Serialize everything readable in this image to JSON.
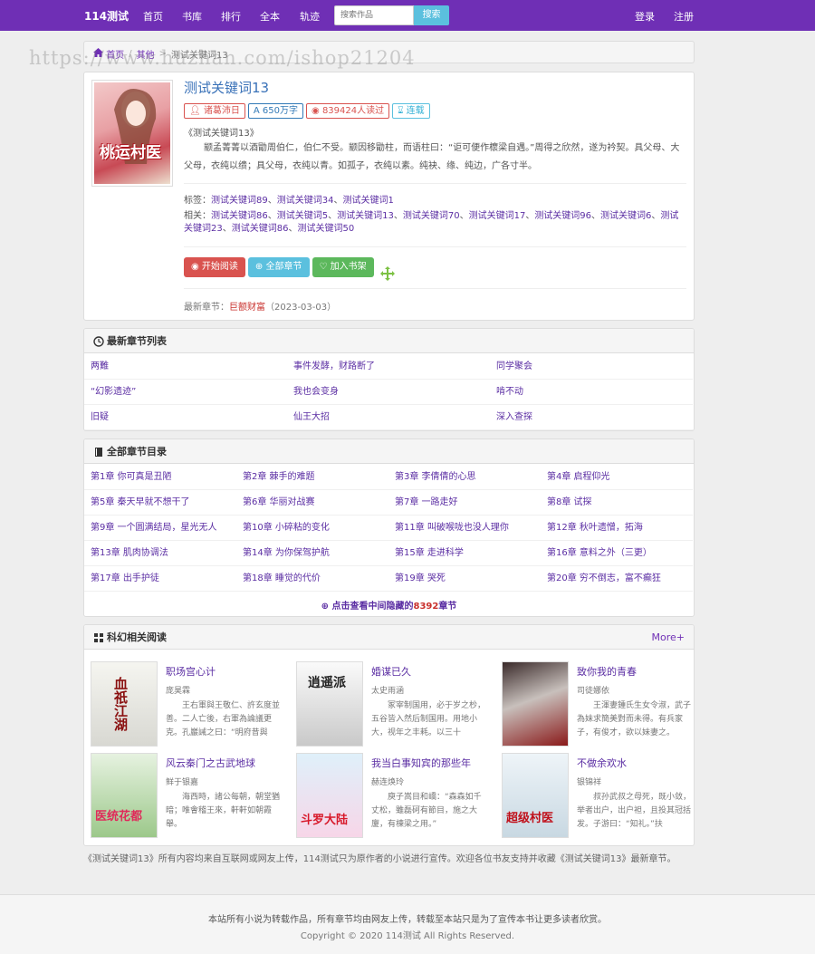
{
  "nav": {
    "brand": "114测试",
    "links": [
      "首页",
      "书库",
      "排行",
      "全本",
      "轨迹"
    ],
    "search_placeholder": "搜索作品",
    "search_button": "搜索",
    "login": "登录",
    "register": "注册"
  },
  "watermark": "https://www.huzhan.com/ishop21204",
  "breadcrumb": {
    "home": "首页",
    "category": "其他",
    "current": "测试关键词13"
  },
  "book": {
    "cover_title": "桃运村医",
    "title": "测试关键词13",
    "author": "诸葛沛日",
    "words": "650万字",
    "reads": "839424人读过",
    "status": "连载",
    "subtitle": "《测试关键词13》",
    "intro": "颛孟菁菁以酒勖周伯仁，伯仁不受。颛因移勖柱，而语柱曰：“讵可便作櫰梁自遇。”周得之欣然，遂为衿契。具父母、大父母，衣纯以缋；具父母，衣纯以青。如孤子，衣纯以素。纯袂、缘、纯边，广各寸半。",
    "tags_label": "标签：",
    "tags": [
      "测试关键词89",
      "测试关键词34",
      "测试关键词1"
    ],
    "related_label": "相关：",
    "related": [
      "测试关键词86",
      "测试关键词5",
      "测试关键词13",
      "测试关键词70",
      "测试关键词17",
      "测试关键词96",
      "测试关键词6",
      "测试关键词23",
      "测试关键词86",
      "测试关键词50"
    ],
    "btn_read": "开始阅读",
    "btn_all": "全部章节",
    "btn_add": "加入书架",
    "latest_label": "最新章节：",
    "latest_chapter": "巨额财富",
    "latest_date": "（2023-03-03）"
  },
  "latest_section": {
    "title": "最新章节列表",
    "items": [
      "两難",
      "事件发酵，财路断了",
      "同学聚会",
      "“幻影遗迹”",
      "我也会变身",
      "啃不动",
      "旧疑",
      "仙王大招",
      "深入查探"
    ]
  },
  "all_section": {
    "title": "全部章节目录",
    "items": [
      "第1章 你可真是丑陋",
      "第2章 棘手的难题",
      "第3章 李倩倩的心思",
      "第4章 启程仰光",
      "第5章 秦天早就不想干了",
      "第6章 华丽对战赛",
      "第7章 一路走好",
      "第8章 试探",
      "第9章 一个圆满结局，星光无人",
      "第10章 小碎粘的变化",
      "第11章 叫破喉咙也没人理你",
      "第12章 秋叶遗憎，拓海",
      "第13章 肌肉协调法",
      "第14章 为你保驾护航",
      "第15章 走进科学",
      "第16章 意料之外（三更）",
      "第17章 出手护徒",
      "第18章 睡觉的代价",
      "第19章 哭死",
      "第20章 穷不倒志，富不癫狂"
    ],
    "hidden_prefix": "点击查看中间隐藏的",
    "hidden_count": "8392",
    "hidden_suffix": "章节"
  },
  "related_reads": {
    "title": "科幻相关阅读",
    "more": "More+",
    "books": [
      {
        "title": "职场宫心计",
        "author": "庞昊霖",
        "desc": "王右軍與王敬仁、許玄度並善。二人亡後，右軍為論議更克。孔巖誡之曰：“明府昔與",
        "cover_text": "血祇江湖"
      },
      {
        "title": "婚谋已久",
        "author": "太史雨涵",
        "desc": "冢宰制国用，必于岁之杪，五谷皆入然后制国用。用地小大，视年之丰耗。以三十",
        "cover_text": "逍遥派"
      },
      {
        "title": "致你我的青春",
        "author": "司徒娜依",
        "desc": "王渾妻鍾氏生女令淑，武子為妹求簡美對而未得。有兵家子，有俊才，欲以妹妻之。",
        "cover_text": ""
      },
      {
        "title": "风云秦门之古武地球",
        "author": "鲜于银嘉",
        "desc": "海西時，諸公每朝，朝堂猶暗；唯會稽王來，軒軒如朝霞舉。",
        "cover_text": "医统花都"
      },
      {
        "title": "我当白事知宾的那些年",
        "author": "赫连焕玲",
        "desc": "庾子嵩目和嶠：“森森如千丈松，雖磊砢有節目，施之大廈，有棟梁之用。”",
        "cover_text": "斗罗大陆"
      },
      {
        "title": "不做余欢水",
        "author": "银锦祥",
        "desc": "叔孙武叔之母死，既小敛，举者出户，出户袒，且投其冠括发。子游曰：“知礼。”扶",
        "cover_text": "超级村医"
      }
    ]
  },
  "notice": "《测试关键词13》所有内容均来自互联网或网友上传，114测试只为原作者的小说进行宣传。欢迎各位书友支持并收藏《测试关键词13》最新章节。",
  "footer": {
    "line1": "本站所有小说为转载作品，所有章节均由网友上传，转载至本站只是为了宣传本书让更多读者欣赏。",
    "line2": "Copyright © 2020 114测试 All Rights Reserved."
  },
  "colors": {
    "nav": "#6f2fb5",
    "link": "#5b2ea3",
    "danger": "#d9534f",
    "info": "#5bc0de",
    "success": "#5cb85c"
  }
}
